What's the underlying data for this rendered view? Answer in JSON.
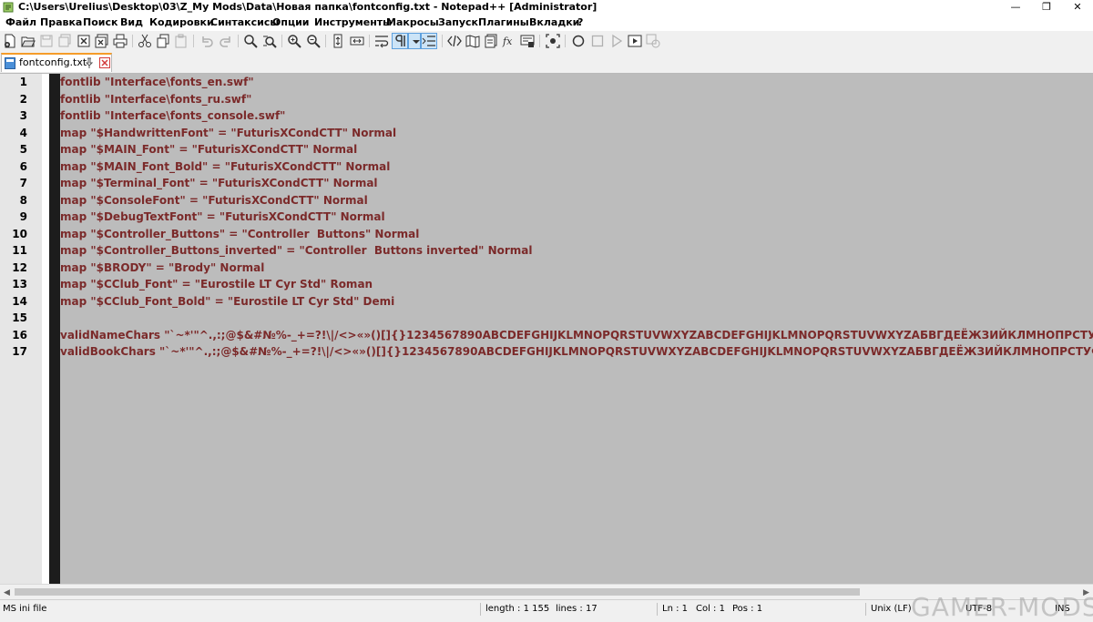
{
  "window": {
    "title": "C:\\Users\\Urelius\\Desktop\\03\\Z_My Mods\\Data\\Новая папка\\fontconfig.txt - Notepad++ [Administrator]",
    "minimize": "—",
    "maximize": "❐",
    "close": "✕"
  },
  "menu": [
    "Файл",
    "Правка",
    "Поиск",
    "Вид",
    "Кодировки",
    "Синтаксисы",
    "Опции",
    "Инструменты",
    "Макросы",
    "Запуск",
    "Плагины",
    "Вкладки",
    "?"
  ],
  "tab": {
    "title": "fontconfig.txt"
  },
  "editor": {
    "line_numbers": [
      "1",
      "2",
      "3",
      "4",
      "5",
      "6",
      "7",
      "8",
      "9",
      "10",
      "11",
      "12",
      "13",
      "14",
      "15",
      "16",
      "17"
    ],
    "lines": [
      "fontlib \"Interface\\fonts_en.swf\"",
      "fontlib \"Interface\\fonts_ru.swf\"",
      "fontlib \"Interface\\fonts_console.swf\"",
      "map \"$HandwrittenFont\" = \"FuturisXCondCTT\" Normal",
      "map \"$MAIN_Font\" = \"FuturisXCondCTT\" Normal",
      "map \"$MAIN_Font_Bold\" = \"FuturisXCondCTT\" Normal",
      "map \"$Terminal_Font\" = \"FuturisXCondCTT\" Normal",
      "map \"$ConsoleFont\" = \"FuturisXCondCTT\" Normal",
      "map \"$DebugTextFont\" = \"FuturisXCondCTT\" Normal",
      "map \"$Controller_Buttons\" = \"Controller  Buttons\" Normal",
      "map \"$Controller_Buttons_inverted\" = \"Controller  Buttons inverted\" Normal",
      "map \"$BRODY\" = \"Brody\" Normal",
      "map \"$CClub_Font\" = \"Eurostile LT Cyr Std\" Roman",
      "map \"$CClub_Font_Bold\" = \"Eurostile LT Cyr Std\" Demi",
      "",
      "validNameChars \"`~*'\"^.,:;@$&#№%-_+=?!\\|/<>«»()[]{}1234567890ABCDEFGHIJKLMNOPQRSTUVWXYZABCDEFGHIJKLMNOPQRSTUVWXYZАБВГДЕЁЖЗИЙКЛМНОПРСТУФХЦЧШЩЪЫЬЭЮЯАБЕ",
      "validBookChars \"`~*'\"^.,:;@$&#№%-_+=?!\\|/<>«»()[]{}1234567890ABCDEFGHIJKLMNOPQRSTUVWXYZABCDEFGHIJKLMNOPQRSTUVWXYZАБВГДЕЁЖЗИЙКЛМНОПРСТУФХЦЧШЩЪЫЬЭЮЯАБВІ"
    ]
  },
  "status": {
    "filetype": "MS ini file",
    "length": "length : 1 155",
    "lines": "lines : 17",
    "ln": "Ln : 1",
    "col": "Col : 1",
    "pos": "Pos : 1",
    "eol": "Unix (LF)",
    "encoding": "UTF-8",
    "mode": "INS"
  },
  "watermark": "GAMER-MODS",
  "colors": {
    "text": "#7b2a2a",
    "editor_bg": "#bcbcbc",
    "tab_accent": "#f59c2a"
  }
}
